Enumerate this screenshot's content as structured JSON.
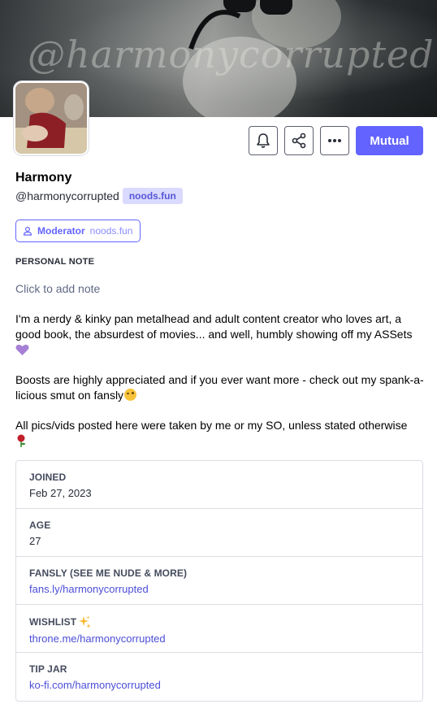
{
  "banner": {
    "watermark": "@harmonycorrupted"
  },
  "actions": {
    "bell_icon": "bell-icon",
    "share_icon": "share-icon",
    "more_icon": "more-icon",
    "primary_label": "Mutual",
    "accent_color": "#6364ff"
  },
  "profile": {
    "display_name": "Harmony",
    "handle": "@harmonycorrupted",
    "domain_badge": "noods.fun",
    "role_icon": "user-icon",
    "role_name": "Moderator",
    "role_domain": "noods.fun"
  },
  "note": {
    "title": "PERSONAL NOTE",
    "placeholder": "Click to add note"
  },
  "bio": {
    "p1": "I'm a nerdy & kinky pan metalhead and adult content creator who loves art, a good book, the absurdest of movies... and well, humbly showing off my ASSets",
    "p2": "Boosts are highly appreciated and if you ever want more - check out my spank-a-licious smut on fansly",
    "p3": " All pics/vids posted here were taken by me or my SO, unless stated otherwise"
  },
  "fields": [
    {
      "label": "JOINED",
      "value": "Feb 27, 2023"
    },
    {
      "label": "AGE",
      "value": "27"
    },
    {
      "label": "FANSLY (SEE ME NUDE & MORE)",
      "value": "fans.ly/harmonycorrupted"
    },
    {
      "label": "WISHLIST",
      "value": "throne.me/harmonycorrupted"
    },
    {
      "label": "TIP JAR",
      "value": "ko-fi.com/harmonycorrupted"
    }
  ]
}
